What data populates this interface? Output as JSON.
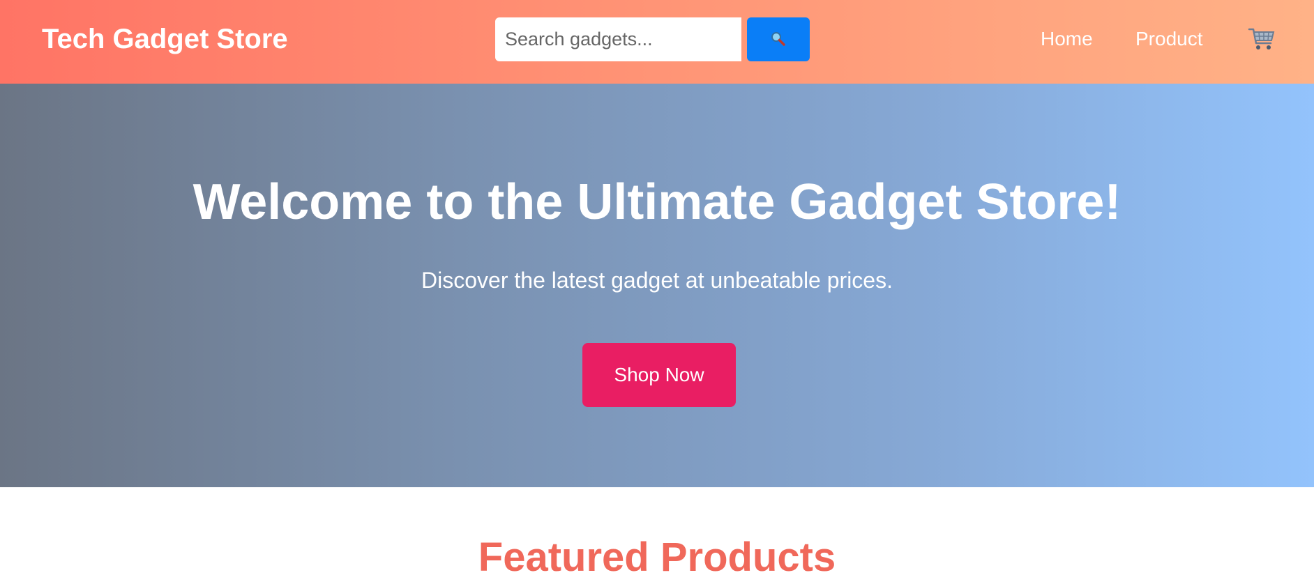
{
  "header": {
    "brand": "Tech Gadget Store",
    "search": {
      "placeholder": "Search gadgets...",
      "value": ""
    },
    "search_button_icon": "search-icon",
    "nav": [
      {
        "label": "Home"
      },
      {
        "label": "Product"
      }
    ],
    "cart_icon": "shopping-cart-icon"
  },
  "hero": {
    "title": "Welcome to the Ultimate Gadget Store!",
    "subtitle": "Discover the latest gadget at unbeatable prices.",
    "cta_label": "Shop Now"
  },
  "featured": {
    "title": "Featured Products"
  },
  "colors": {
    "header_gradient_start": "#ff7465",
    "header_gradient_end": "#ffb287",
    "hero_gradient_start": "#6b7585",
    "hero_gradient_end": "#93c3fc",
    "search_button": "#0a7ef7",
    "cta_button": "#e91e63",
    "featured_title": "#f0685a"
  }
}
